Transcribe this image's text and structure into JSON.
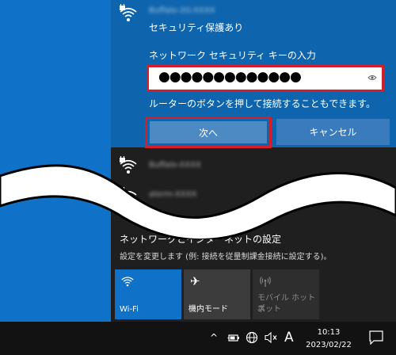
{
  "selected_network": {
    "ssid_obscured": "Buffalo-2G-XXXX",
    "security": "セキュリティ保護あり",
    "key_label": "ネットワーク セキュリティ キーの入力",
    "password_mask": "●●●●●●●●●●●●●",
    "hint": "ルーターのボタンを押して接続することもできます。",
    "next_button": "次へ",
    "cancel_button": "キャンセル"
  },
  "other_networks": [
    {
      "ssid_obscured": "Buffalo-XXXX"
    },
    {
      "ssid_obscured": "aterm-XXXX"
    }
  ],
  "network_settings": {
    "title": "ネットワークとインターネットの設定",
    "description": "設定を変更します (例: 接続を従量制課金接続に設定する)。"
  },
  "quick_actions": [
    {
      "label": "Wi-Fi",
      "icon": "wifi-icon"
    },
    {
      "label": "機内モード",
      "icon": "airplane-icon"
    },
    {
      "label_line1": "モバイル ホットス",
      "label_line2": "ポット",
      "icon": "mobile-hotspot-icon"
    }
  ],
  "taskbar": {
    "ime_mode": "A",
    "time": "10:13",
    "date": "2023/02/22"
  },
  "colors": {
    "accent": "#0f65ad",
    "desktop": "#0f72c8",
    "highlight_border": "#d1202b",
    "flyout_bg": "#1f1f1f"
  }
}
